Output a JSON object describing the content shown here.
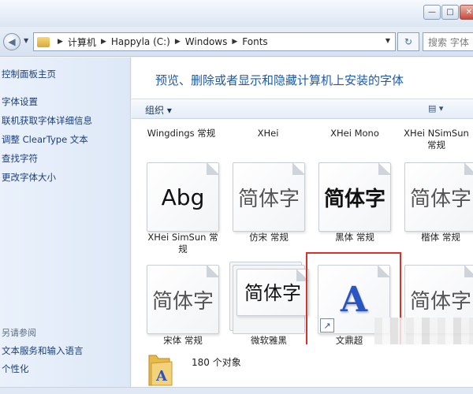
{
  "window": {
    "minimize_glyph": "—",
    "maximize_glyph": "□",
    "close_glyph": "✕"
  },
  "address": {
    "crumbs": [
      "计算机",
      "Happyla (C:)",
      "Windows",
      "Fonts"
    ],
    "search_placeholder": "搜索 字体"
  },
  "sidebar": {
    "items": [
      {
        "label": "控制面板主页"
      },
      {
        "label": "字体设置"
      },
      {
        "label": "联机获取字体详细信息"
      },
      {
        "label": "调整 ClearType 文本"
      },
      {
        "label": "查找字符"
      },
      {
        "label": "更改字体大小"
      }
    ],
    "see_also_title": "另请参阅",
    "see_also": [
      {
        "label": "文本服务和输入语言"
      },
      {
        "label": "个性化"
      }
    ]
  },
  "main": {
    "heading": "预览、删除或者显示和隐藏计算机上安装的字体",
    "toolbar": {
      "organize_label": "组织 ▾",
      "view_label": "▤ ▾"
    },
    "top_row_labels": [
      "Wingdings 常规",
      "XHei",
      "XHei Mono",
      "XHei NSimSun 常规"
    ],
    "fonts_row1": [
      {
        "sample": "Abg",
        "label": "XHei SimSun 常规"
      },
      {
        "sample": "简体字",
        "label": "仿宋 常规"
      },
      {
        "sample": "简体字",
        "label": "黑体 常规"
      },
      {
        "sample": "简体字",
        "label": "楷体 常规"
      }
    ],
    "fonts_row2": [
      {
        "sample": "简体字",
        "label": "宋体 常规"
      },
      {
        "sample": "简体字",
        "label": "微软雅黑"
      },
      {
        "sample": "A",
        "label": "文鼎超"
      },
      {
        "sample": "简体字",
        "label": ""
      }
    ],
    "status": {
      "count_text": "180 个对象"
    }
  },
  "colors": {
    "heading": "#1d5aa8",
    "link": "#1b3e7a",
    "highlight_border": "#d9312a",
    "glyph_a": "#2a55c0"
  },
  "icons": [
    "back-icon",
    "dropdown-icon",
    "folder-icon",
    "refresh-icon",
    "view-icon",
    "font-file-icon",
    "shortcut-arrow-icon"
  ]
}
